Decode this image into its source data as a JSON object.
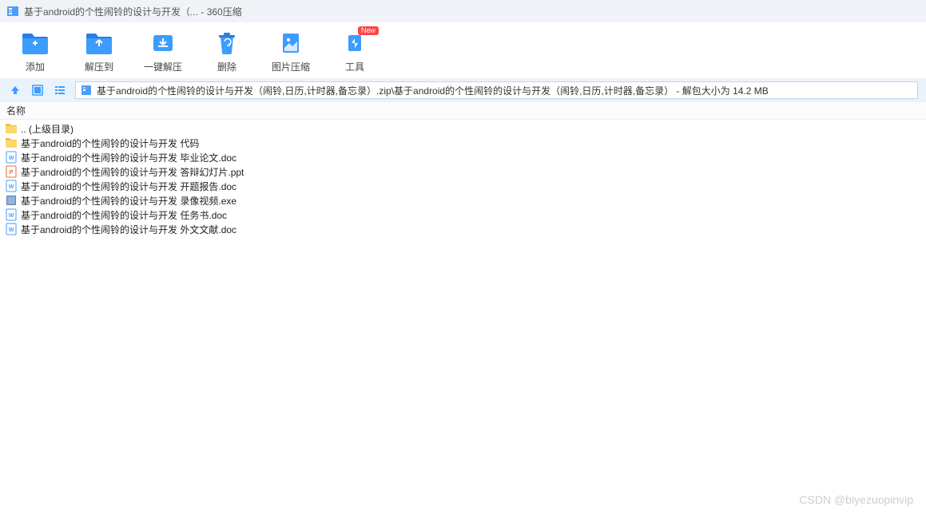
{
  "window": {
    "title": "基于android的个性闹铃的设计与开发（... - 360压缩"
  },
  "toolbar": {
    "add": "添加",
    "extract_to": "解压到",
    "one_click_extract": "一键解压",
    "delete": "删除",
    "image_compress": "图片压缩",
    "tools": "工具",
    "tools_badge": "New"
  },
  "path": {
    "text": "基于android的个性闹铃的设计与开发（闹铃,日历,计时器,备忘录）.zip\\基于android的个性闹铃的设计与开发（闹铃,日历,计时器,备忘录） - 解包大小为 14.2 MB"
  },
  "columns": {
    "name": "名称"
  },
  "files": [
    {
      "icon": "folder-up",
      "name": ".. (上级目录)"
    },
    {
      "icon": "folder",
      "name": "基于android的个性闹铃的设计与开发 代码"
    },
    {
      "icon": "doc",
      "name": "基于android的个性闹铃的设计与开发 毕业论文.doc"
    },
    {
      "icon": "ppt",
      "name": "基于android的个性闹铃的设计与开发 答辩幻灯片.ppt"
    },
    {
      "icon": "doc",
      "name": "基于android的个性闹铃的设计与开发 开题报告.doc"
    },
    {
      "icon": "exe",
      "name": "基于android的个性闹铃的设计与开发 录像视频.exe"
    },
    {
      "icon": "doc",
      "name": "基于android的个性闹铃的设计与开发 任务书.doc"
    },
    {
      "icon": "doc",
      "name": "基于android的个性闹铃的设计与开发 外文文献.doc"
    }
  ],
  "watermark": "CSDN @biyezuopinvip"
}
